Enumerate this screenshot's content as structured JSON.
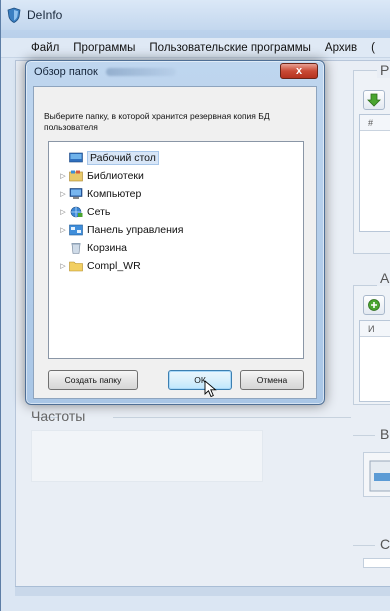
{
  "app": {
    "title": "DeInfo",
    "menu": [
      "Файл",
      "Программы",
      "Пользовательские программы",
      "Архив",
      "("
    ]
  },
  "panels": {
    "right_top_label": "Р",
    "right_mid_label": "А",
    "right_bottom_label": "В",
    "right_last_label": "С",
    "table_head_1": "#",
    "table_head_2": "И",
    "frequencies_label": "Частоты"
  },
  "dialog": {
    "title": "Обзор папок",
    "close_label": "x",
    "description": "Выберите папку, в которой хранится резервная копия БД пользователя",
    "tree": [
      {
        "label": "Рабочий стол",
        "icon": "desktop-icon",
        "expandable": false,
        "selected": true
      },
      {
        "label": "Библиотеки",
        "icon": "libraries-icon",
        "expandable": true,
        "selected": false
      },
      {
        "label": "Компьютер",
        "icon": "computer-icon",
        "expandable": true,
        "selected": false
      },
      {
        "label": "Сеть",
        "icon": "network-icon",
        "expandable": true,
        "selected": false
      },
      {
        "label": "Панель управления",
        "icon": "control-panel-icon",
        "expandable": true,
        "selected": false
      },
      {
        "label": "Корзина",
        "icon": "recycle-bin-icon",
        "expandable": false,
        "selected": false
      },
      {
        "label": "Compl_WR",
        "icon": "folder-icon",
        "expandable": true,
        "selected": false
      }
    ],
    "buttons": {
      "new_folder": "Создать папку",
      "ok": "ОК",
      "cancel": "Отмена"
    }
  },
  "colors": {
    "dialog_frame": "#a9c6e6",
    "close_red": "#c94a35",
    "selection": "#d8e6f7",
    "default_button_border": "#3c7fb1"
  }
}
